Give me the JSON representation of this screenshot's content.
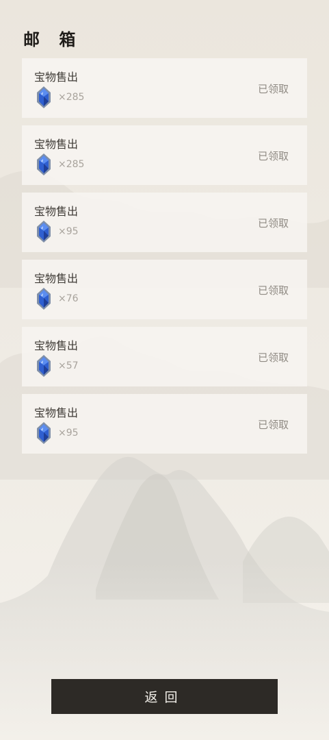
{
  "header": {
    "title": "邮 箱"
  },
  "mails": [
    {
      "subject": "宝物售出",
      "reward_icon": "blue-gem-icon",
      "reward_count": "×285",
      "status": "已领取"
    },
    {
      "subject": "宝物售出",
      "reward_icon": "blue-gem-icon",
      "reward_count": "×285",
      "status": "已领取"
    },
    {
      "subject": "宝物售出",
      "reward_icon": "blue-gem-icon",
      "reward_count": "×95",
      "status": "已领取"
    },
    {
      "subject": "宝物售出",
      "reward_icon": "blue-gem-icon",
      "reward_count": "×76",
      "status": "已领取"
    },
    {
      "subject": "宝物售出",
      "reward_icon": "blue-gem-icon",
      "reward_count": "×57",
      "status": "已领取"
    },
    {
      "subject": "宝物售出",
      "reward_icon": "blue-gem-icon",
      "reward_count": "×95",
      "status": "已领取"
    }
  ],
  "footer": {
    "back_label": "返回"
  },
  "theme": {
    "paper": "#efece5",
    "card": "#f7f5f1",
    "ink": "#1f1c19",
    "button": "#2d2a26",
    "gem_blue": "#2f5fd0"
  }
}
